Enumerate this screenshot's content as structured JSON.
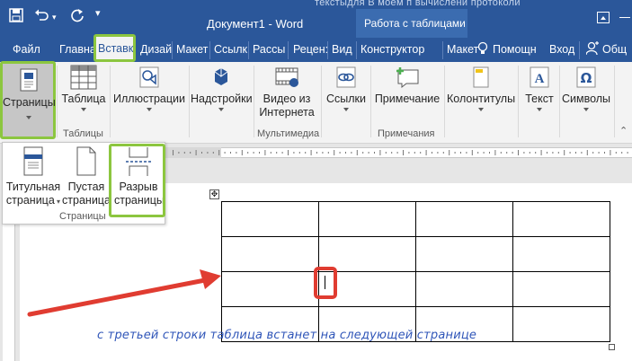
{
  "window": {
    "title": "Документ1 - Word",
    "context_group": "Работа с таблицами",
    "background_text": "текстыдля   В моем п   вычислени   протоколи"
  },
  "quick_access": {
    "save_icon": "save-icon",
    "undo_icon": "undo-icon",
    "redo_icon": "redo-icon"
  },
  "tabs": {
    "file": "Файл",
    "home": "Главна",
    "insert": "Вставк",
    "design": "Дизай",
    "layout": "Макет",
    "references": "Ссылк",
    "mailings": "Рассы",
    "review": "Рецен:",
    "view": "Вид",
    "constructor": "Конструктор",
    "table_layout": "Макет",
    "tell_me": "Помощн",
    "signin": "Вход",
    "share": "Общ"
  },
  "ribbon": {
    "pages": "Страницы",
    "table": "Таблица",
    "illustrations": "Иллюстрации",
    "addins": "Надстройки",
    "online_video_line1": "Видео из",
    "online_video_line2": "Интернета",
    "links": "Ссылки",
    "comment": "Примечание",
    "header_footer": "Колонтитулы",
    "text": "Текст",
    "symbols": "Символы",
    "groups": {
      "tables": "Таблицы",
      "media": "Мультимедиа",
      "comments": "Примечания"
    }
  },
  "pages_dropdown": {
    "cover_line1": "Титульная",
    "cover_line2": "страница",
    "blank_line1": "Пустая",
    "blank_line2": "страница",
    "break_line1": "Разрыв",
    "break_line2": "страницы",
    "group_label": "Страницы"
  },
  "annotation": "с третьей строки таблица встанет на следующей странице",
  "table_rows": 4,
  "table_cols": 4,
  "colors": {
    "word_blue": "#2b579a",
    "highlight_green": "#8cc63f",
    "highlight_red": "#e03c31",
    "annotation_blue": "#2f55b8"
  }
}
